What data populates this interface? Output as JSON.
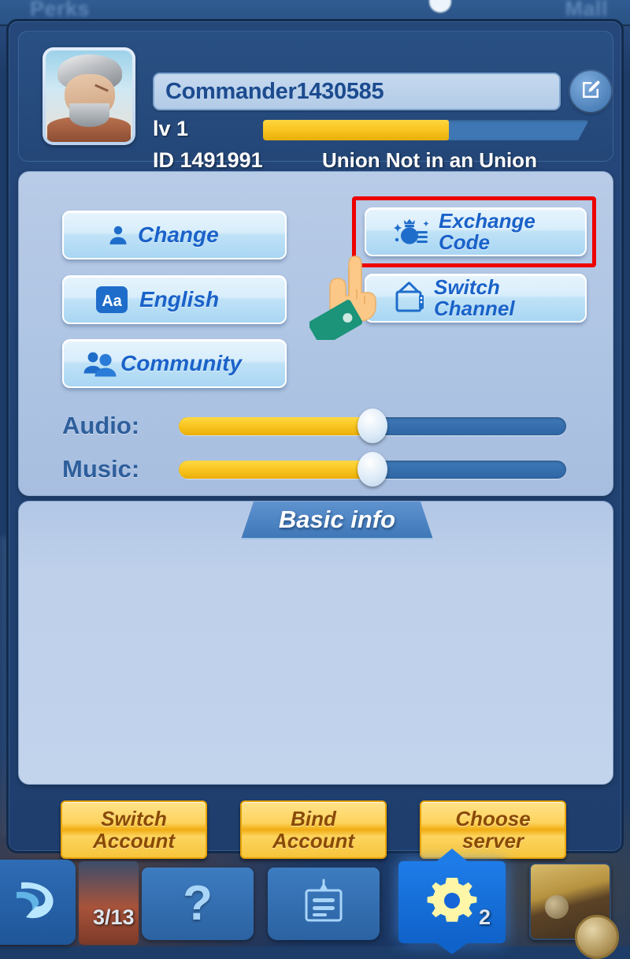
{
  "background": {
    "ghost_label_left": "Perks",
    "ghost_label_right": "Mall"
  },
  "profile": {
    "avatar_name": "commander-portrait",
    "player_name": "Commander1430585",
    "edit_icon": "edit-pencil-icon",
    "level_label": "lv 1",
    "xp_percent": 57,
    "player_id": "ID 1491991",
    "union_status": "Union Not in an Union"
  },
  "options": {
    "buttons": [
      {
        "id": "change",
        "label": "Change",
        "icon": "person-icon",
        "two_line": false
      },
      {
        "id": "language",
        "label": "English",
        "icon": "language-aa-icon",
        "two_line": false
      },
      {
        "id": "community",
        "label": "Community",
        "icon": "people-icon",
        "two_line": false
      },
      {
        "id": "exchange-code",
        "label": "Exchange\nCode",
        "icon": "money-bag-icon",
        "two_line": true,
        "highlighted": true
      },
      {
        "id": "switch-channel",
        "label": "Switch\nChannel",
        "icon": "tv-icon",
        "two_line": true
      }
    ],
    "highlight_color": "#ee0000",
    "sliders": [
      {
        "id": "audio",
        "label": "Audio:",
        "value": 50
      },
      {
        "id": "music",
        "label": "Music:",
        "value": 50
      }
    ]
  },
  "basic_info": {
    "tab_title": "Basic info",
    "body_text": ""
  },
  "account_actions": [
    {
      "id": "switch-account",
      "label": "Switch\nAccount"
    },
    {
      "id": "bind-account",
      "label": "Bind\nAccount"
    },
    {
      "id": "choose-server",
      "label": "Choose\nserver"
    }
  ],
  "bottom_nav": {
    "logo_icon": "game-logo-icon",
    "items": [
      {
        "id": "help",
        "icon": "question-mark-icon",
        "label": "?"
      },
      {
        "id": "notice",
        "icon": "notice-board-icon",
        "label": ""
      },
      {
        "id": "settings",
        "icon": "gear-icon",
        "label": "",
        "selected": true
      }
    ],
    "counter_left": "3/13",
    "counter_right": "2",
    "chest_icon": "treasure-chest-icon",
    "compass_icon": "compass-icon"
  },
  "colors": {
    "window_blue": "#224373",
    "panel_blue": "#b0c6e4",
    "button_blue_text": "#1a62c9",
    "gold": "#f7c53c",
    "gold_text": "#8a4a06",
    "highlight_red": "#ee0000",
    "accent_yellow": "#ffd942"
  }
}
